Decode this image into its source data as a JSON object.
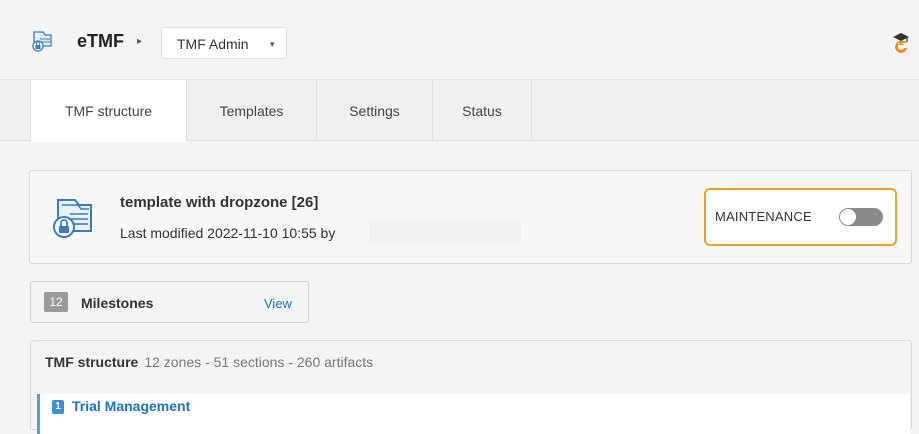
{
  "header": {
    "app_title": "eTMF",
    "app_icon": "folder-lock-icon",
    "breadcrumb_icon": "caret-right-icon",
    "module_select": {
      "value": "TMF Admin"
    },
    "brand_icon": "brand-logo-icon"
  },
  "tabs": [
    {
      "label": "TMF structure",
      "active": true
    },
    {
      "label": "Templates",
      "active": false
    },
    {
      "label": "Settings",
      "active": false
    },
    {
      "label": "Status",
      "active": false
    }
  ],
  "template": {
    "name": "template with dropzone [26]",
    "meta": "Last modified 2022-11-10 10:55 by",
    "icon": "template-lock-icon"
  },
  "maintenance": {
    "label": "MAINTENANCE",
    "enabled": false,
    "highlight_color": "#f0a020"
  },
  "milestones": {
    "count": "12",
    "label": "Milestones",
    "view_label": "View"
  },
  "structure": {
    "title": "TMF structure",
    "summary": "12 zones - 51 sections - 260 artifacts",
    "zones": [
      {
        "number": "1",
        "name": "Trial Management"
      }
    ]
  },
  "colors": {
    "accent_blue": "#1a73c9",
    "zone_badge": "#3d8fd8"
  }
}
